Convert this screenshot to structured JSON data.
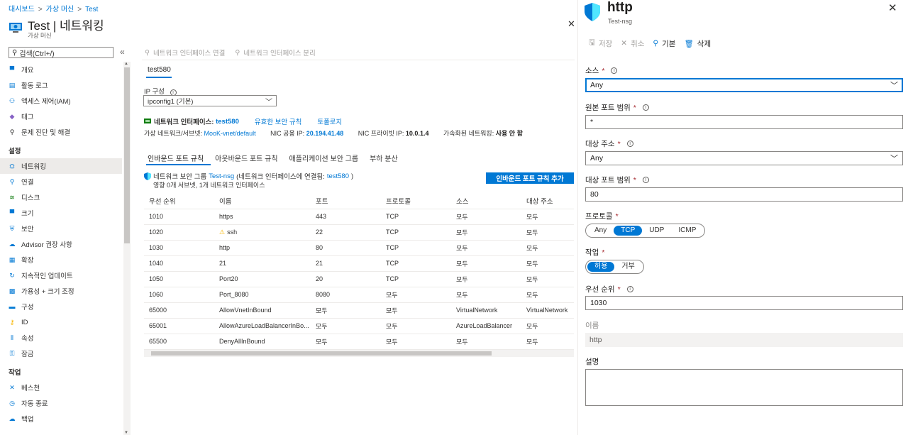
{
  "breadcrumb": [
    "대시보드",
    "가상 머신",
    "Test"
  ],
  "header": {
    "title": "Test | 네트워킹",
    "subtitle": "가상 머신"
  },
  "search": {
    "placeholder": "검색(Ctrl+/)"
  },
  "nav": {
    "items_top": [
      {
        "label": "개요",
        "icon": "monitor-icon",
        "color": "#0078d4"
      },
      {
        "label": "활동 로그",
        "icon": "log-icon",
        "color": "#0078d4"
      },
      {
        "label": "액세스 제어(IAM)",
        "icon": "people-icon",
        "color": "#0078d4"
      },
      {
        "label": "태그",
        "icon": "tag-icon",
        "color": "#8661c5"
      },
      {
        "label": "문제 진단 및 해결",
        "icon": "wrench-icon",
        "color": "#323130"
      }
    ],
    "section_settings": "설정",
    "items_settings": [
      {
        "label": "네트워킹",
        "icon": "network-icon",
        "color": "#0078d4",
        "active": true
      },
      {
        "label": "연결",
        "icon": "connect-icon",
        "color": "#0078d4"
      },
      {
        "label": "디스크",
        "icon": "disk-icon",
        "color": "#107c10"
      },
      {
        "label": "크기",
        "icon": "size-icon",
        "color": "#0078d4"
      },
      {
        "label": "보안",
        "icon": "security-icon",
        "color": "#0078d4"
      },
      {
        "label": "Advisor 권장 사항",
        "icon": "advisor-icon",
        "color": "#0078d4"
      },
      {
        "label": "확장",
        "icon": "extension-icon",
        "color": "#0078d4"
      },
      {
        "label": "지속적인 업데이트",
        "icon": "update-icon",
        "color": "#0078d4"
      },
      {
        "label": "가용성 + 크기 조정",
        "icon": "availability-icon",
        "color": "#0078d4"
      },
      {
        "label": "구성",
        "icon": "config-icon",
        "color": "#0078d4"
      },
      {
        "label": "ID",
        "icon": "identity-icon",
        "color": "#f7b500"
      },
      {
        "label": "속성",
        "icon": "properties-icon",
        "color": "#0078d4"
      },
      {
        "label": "잠금",
        "icon": "lock-icon",
        "color": "#0078d4"
      }
    ],
    "section_ops": "작업",
    "items_ops": [
      {
        "label": "베스천",
        "icon": "bastion-icon",
        "color": "#0078d4"
      },
      {
        "label": "자동 종료",
        "icon": "clock-icon",
        "color": "#0078d4"
      },
      {
        "label": "백업",
        "icon": "backup-icon",
        "color": "#0078d4"
      }
    ]
  },
  "toolbar": {
    "attach": "네트워크 인터페이스 연결",
    "detach": "네트워크 인터페이스 분리"
  },
  "nic_tab": "test580",
  "ipconfig": {
    "label": "IP 구성",
    "value": "ipconfig1 (기본)"
  },
  "nic": {
    "label": "네트워크 인터페이스:",
    "name": "test580",
    "effective_rules": "유효한 보안 규칙",
    "topology": "토폴로지"
  },
  "vnet": {
    "vnet_label": "가상 네트워크/서브넷:",
    "vnet_value": "MooK-vnet/default",
    "public_ip_label": "NIC 공용 IP:",
    "public_ip": "20.194.41.48",
    "private_ip_label": "NIC 프라이빗 IP:",
    "private_ip": "10.0.1.4",
    "accel_label": "가속화된 네트워킹:",
    "accel_value": "사용 안 함"
  },
  "rule_tabs": [
    "인바운드 포트 규칙",
    "아웃바운드 포트 규칙",
    "애플리케이션 보안 그룹",
    "부하 분산"
  ],
  "nsg": {
    "prefix": "네트워크 보안 그룹",
    "name": "Test-nsg",
    "attached_prefix": "(네트워크 인터페이스에 연결됨:",
    "attached_nic": "test580",
    "attached_suffix": ")",
    "impact": "영향 0개 서브넷, 1개 네트워크 인터페이스"
  },
  "add_rule_label": "인바운드 포트 규칙 추가",
  "rules": {
    "headers": [
      "우선 순위",
      "이름",
      "포트",
      "프로토콜",
      "소스",
      "대상 주소"
    ],
    "rows": [
      {
        "priority": "1010",
        "name": "https",
        "port": "443",
        "protocol": "TCP",
        "source": "모두",
        "dest": "모두",
        "warn": false
      },
      {
        "priority": "1020",
        "name": "ssh",
        "port": "22",
        "protocol": "TCP",
        "source": "모두",
        "dest": "모두",
        "warn": true
      },
      {
        "priority": "1030",
        "name": "http",
        "port": "80",
        "protocol": "TCP",
        "source": "모두",
        "dest": "모두",
        "warn": false
      },
      {
        "priority": "1040",
        "name": "21",
        "port": "21",
        "protocol": "TCP",
        "source": "모두",
        "dest": "모두",
        "warn": false
      },
      {
        "priority": "1050",
        "name": "Port20",
        "port": "20",
        "protocol": "TCP",
        "source": "모두",
        "dest": "모두",
        "warn": false
      },
      {
        "priority": "1060",
        "name": "Port_8080",
        "port": "8080",
        "protocol": "모두",
        "source": "모두",
        "dest": "모두",
        "warn": false
      },
      {
        "priority": "65000",
        "name": "AllowVnetInBound",
        "port": "모두",
        "protocol": "모두",
        "source": "VirtualNetwork",
        "dest": "VirtualNetwork",
        "warn": false
      },
      {
        "priority": "65001",
        "name": "AllowAzureLoadBalancerInBo...",
        "port": "모두",
        "protocol": "모두",
        "source": "AzureLoadBalancer",
        "dest": "모두",
        "warn": false
      },
      {
        "priority": "65500",
        "name": "DenyAllInBound",
        "port": "모두",
        "protocol": "모두",
        "source": "모두",
        "dest": "모두",
        "warn": false
      }
    ]
  },
  "panel": {
    "title": "http",
    "subtitle": "Test-nsg",
    "toolbar": {
      "save": "저장",
      "discard": "취소",
      "basic": "기본",
      "delete": "삭제"
    },
    "source_label": "소스",
    "source_value": "Any",
    "src_port_label": "원본 포트 범위",
    "src_port_value": "*",
    "dest_label": "대상 주소",
    "dest_value": "Any",
    "dest_port_label": "대상 포트 범위",
    "dest_port_value": "80",
    "protocol_label": "프로토콜",
    "protocol_options": [
      "Any",
      "TCP",
      "UDP",
      "ICMP"
    ],
    "protocol_selected": "TCP",
    "action_label": "작업",
    "action_options": [
      "허용",
      "거부"
    ],
    "action_selected": "허용",
    "priority_label": "우선 순위",
    "priority_value": "1030",
    "name_label": "이름",
    "name_value": "http",
    "desc_label": "설명",
    "required_mark": "*"
  },
  "colors": {
    "accent": "#0078d4",
    "warning": "#f7b500"
  }
}
